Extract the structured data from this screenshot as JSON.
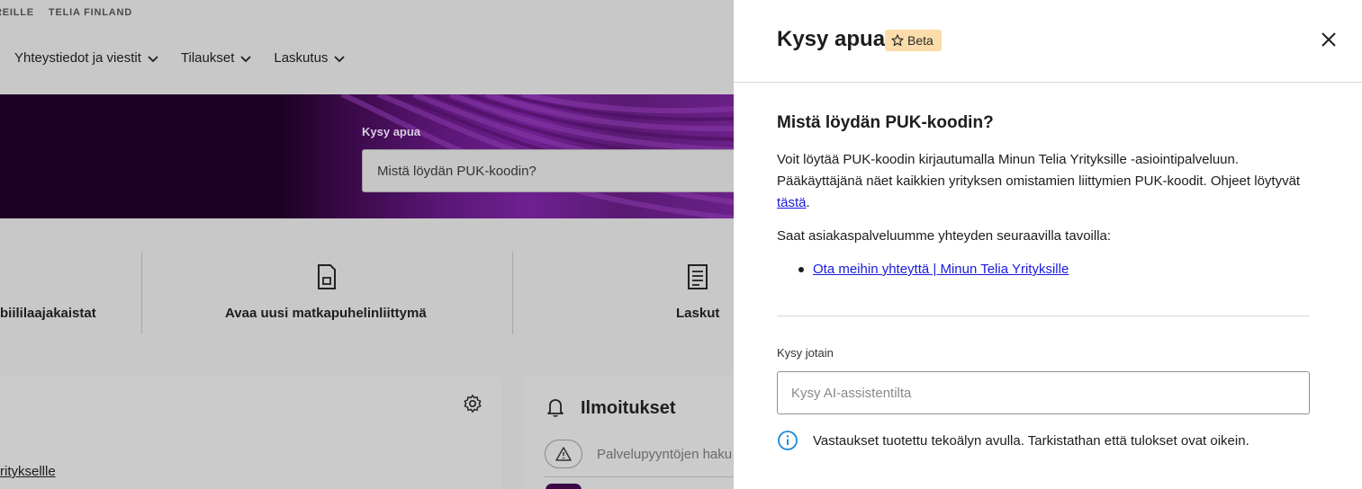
{
  "background": {
    "topbar": {
      "item1": "REILLE",
      "item2": "TELIA FINLAND"
    },
    "nav": [
      {
        "label": "Yhteystiedot ja viestit"
      },
      {
        "label": "Tilaukset"
      },
      {
        "label": "Laskutus"
      }
    ],
    "hero": {
      "label": "Kysy apua",
      "input_value": "Mistä löydän PUK-koodin?"
    },
    "quick_links": {
      "item1": "biililaajakaistat",
      "item2": "Avaa uusi matkapuhelinliittymä",
      "item3": "Laskut"
    },
    "company_link": "rityksellle",
    "notifications": {
      "title": "Ilmoitukset",
      "first_item": "Palvelupyyntöjen haku"
    }
  },
  "panel": {
    "title": "Kysy apua",
    "badge": "Beta",
    "question": "Mistä löydän PUK-koodin?",
    "answer_part1": "Voit löytää PUK-koodin kirjautumalla Minun Telia Yrityksille -asiointipalveluun. Pääkäyttäjänä näet kaikkien yrityksen omistamien liittymien PUK-koodit. Ohjeet löytyvät ",
    "answer_link": "tästä",
    "answer_part2": ".",
    "contact_intro": "Saat asiakaspalveluumme yhteyden seuraavilla tavoilla:",
    "contact_link": "Ota meihin yhteyttä | Minun Telia Yrityksille",
    "ask_label": "Kysy jotain",
    "ask_placeholder": "Kysy AI-assistentilta",
    "ask_value": "",
    "disclaimer": "Vastaukset tuotettu tekoälyn avulla. Tarkistathan että tulokset ovat oikein."
  },
  "colors": {
    "badge_bg": "#fbdcaa",
    "link": "#1a1adb",
    "info_icon": "#1a8ad8",
    "hero_dark": "#1e0024",
    "hero_purple": "#6e2090"
  },
  "icons": {
    "close": "close-icon",
    "badge": "star-icon",
    "info": "info-icon",
    "settings": "gear-icon",
    "notifications": "bell-icon",
    "sim": "sim-card-icon",
    "invoice": "invoice-icon",
    "warning": "warning-icon",
    "chevron": "chevron-down-icon"
  }
}
